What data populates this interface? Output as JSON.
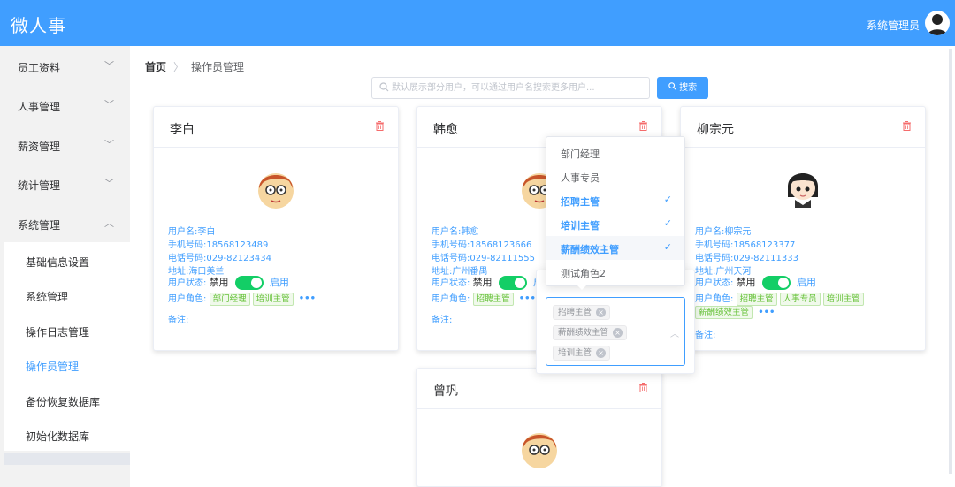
{
  "header": {
    "logo": "微人事",
    "user_name": "系统管理员"
  },
  "sidebar": {
    "menus": [
      {
        "label": "员工资料",
        "arrow": "﹀"
      },
      {
        "label": "人事管理",
        "arrow": "﹀"
      },
      {
        "label": "薪资管理",
        "arrow": "﹀"
      },
      {
        "label": "统计管理",
        "arrow": "﹀"
      },
      {
        "label": "系统管理",
        "arrow": "︿"
      }
    ],
    "submenu": [
      "基础信息设置",
      "系统管理",
      "操作日志管理",
      "操作员管理",
      "备份恢复数据库",
      "初始化数据库"
    ]
  },
  "breadcrumb": {
    "home": "首页",
    "sep": "〉",
    "current": "操作员管理"
  },
  "search": {
    "placeholder": "默认展示部分用户，可以通过用户名搜索更多用户...",
    "button": "搜索",
    "icon": "search-icon"
  },
  "cards": [
    {
      "name": "李白",
      "username": "用户名:李白",
      "phone": "手机号码:18568123489",
      "tel": "电话号码:029-82123434",
      "address": "地址:海口美兰",
      "status_label": "用户状态:",
      "off": "禁用",
      "on": "启用",
      "enabled": true,
      "roles_label": "用户角色:",
      "roles": [
        "部门经理",
        "培训主管"
      ],
      "more": "•••",
      "remark": "备注:"
    },
    {
      "name": "韩愈",
      "username": "用户名:韩愈",
      "phone": "手机号码:18568123666",
      "tel": "电话号码:029-82111555",
      "address": "地址:广州番禺",
      "status_label": "用户状态:",
      "off": "禁用",
      "on": "启用",
      "enabled": true,
      "roles_label": "用户角色:",
      "roles": [
        "招聘主管"
      ],
      "more": "•••",
      "remark": "备注:"
    },
    {
      "name": "柳宗元",
      "username": "用户名:柳宗元",
      "phone": "手机号码:18568123377",
      "tel": "电话号码:029-82111333",
      "address": "地址:广州天河",
      "status_label": "用户状态:",
      "off": "禁用",
      "on": "启用",
      "enabled": true,
      "roles_label": "用户角色:",
      "roles": [
        "招聘主管",
        "人事专员",
        "培训主管",
        "薪酬绩效主管"
      ],
      "more": "•••",
      "remark": "备注:"
    },
    {
      "name": "曾巩"
    }
  ],
  "role_dropdown": {
    "options": [
      {
        "label": "部门经理",
        "selected": false,
        "check": ""
      },
      {
        "label": "人事专员",
        "selected": false,
        "check": ""
      },
      {
        "label": "招聘主管",
        "selected": true,
        "check": "✓"
      },
      {
        "label": "培训主管",
        "selected": true,
        "check": "✓"
      },
      {
        "label": "薪酬绩效主管",
        "selected": true,
        "check": "✓"
      },
      {
        "label": "测试角色2",
        "selected": false,
        "check": ""
      }
    ]
  },
  "role_select": {
    "tags": [
      "招聘主管",
      "薪酬绩效主管",
      "培训主管"
    ],
    "close": "×",
    "caret": "︿"
  },
  "colors": {
    "primary": "#409eff",
    "success": "#13ce66",
    "danger": "#f56c6c"
  }
}
